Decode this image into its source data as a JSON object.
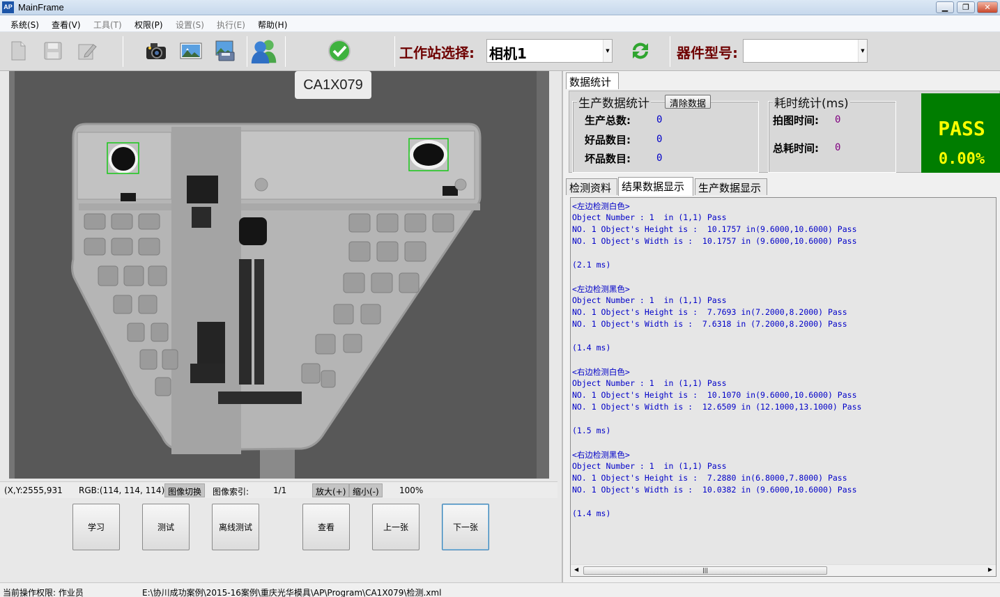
{
  "app": {
    "icon_text": "AP",
    "title": "MainFrame"
  },
  "window_buttons": {
    "minimize": "▁",
    "restore": "❐",
    "close": "✕"
  },
  "menu": [
    {
      "label": "系统(S)",
      "enabled": true
    },
    {
      "label": "查看(V)",
      "enabled": true
    },
    {
      "label": "工具(T)",
      "enabled": false
    },
    {
      "label": "权限(P)",
      "enabled": true
    },
    {
      "label": "设置(S)",
      "enabled": false
    },
    {
      "label": "执行(E)",
      "enabled": false
    },
    {
      "label": "帮助(H)",
      "enabled": true
    }
  ],
  "toolbar": {
    "icons": [
      "new-file-icon",
      "save-icon",
      "edit-icon",
      "camera-icon",
      "image-icon",
      "save-image-icon",
      "users-icon",
      "run-check-icon",
      "refresh-icon"
    ],
    "station_label": "工作站选择:",
    "station_value": "相机1",
    "part_label": "器件型号:",
    "part_value": ""
  },
  "image_view": {
    "part_code": "CA1X079"
  },
  "image_status": {
    "coords": "(X,Y:2555,931",
    "rgb": "RGB:(114, 114, 114)",
    "switch": "图像切换",
    "index_label": "图像索引:",
    "index_value": "1/1",
    "zoom_in": "放大(+)",
    "zoom_out": "缩小(-)",
    "zoom_value": "100%"
  },
  "actions": [
    "学习",
    "测试",
    "离线测试",
    "查看",
    "上一张",
    "下一张"
  ],
  "right": {
    "top_tab": "数据统计",
    "production": {
      "title": "生产数据统计",
      "clear": "清除数据",
      "total_label": "生产总数:",
      "total": "0",
      "good_label": "好品数目:",
      "good": "0",
      "bad_label": "坏品数目:",
      "bad": "0"
    },
    "timing": {
      "title": "耗时统计(ms)",
      "capture_label": "拍图时间:",
      "capture": "0",
      "total_label": "总耗时间:",
      "total": "0"
    },
    "result": {
      "status": "PASS",
      "rate": "0.00%"
    },
    "tabs": [
      "检测资料",
      "结果数据显示",
      "生产数据显示"
    ],
    "active_tab": 1,
    "log": [
      "<左边检测白色>",
      "Object Number : 1  in (1,1) Pass",
      "NO. 1 Object's Height is :  10.1757 in(9.6000,10.6000) Pass",
      "NO. 1 Object's Width is :  10.1757 in (9.6000,10.6000) Pass",
      "",
      "(2.1 ms)",
      "",
      "<左边检测黑色>",
      "Object Number : 1  in (1,1) Pass",
      "NO. 1 Object's Height is :  7.7693 in(7.2000,8.2000) Pass",
      "NO. 1 Object's Width is :  7.6318 in (7.2000,8.2000) Pass",
      "",
      "(1.4 ms)",
      "",
      "<右边检测白色>",
      "Object Number : 1  in (1,1) Pass",
      "NO. 1 Object's Height is :  10.1070 in(9.6000,10.6000) Pass",
      "NO. 1 Object's Width is :  12.6509 in (12.1000,13.1000) Pass",
      "",
      "(1.5 ms)",
      "",
      "<右边检测黑色>",
      "Object Number : 1  in (1,1) Pass",
      "NO. 1 Object's Height is :  7.2880 in(6.8000,7.8000) Pass",
      "NO. 1 Object's Width is :  10.0382 in (9.6000,10.6000) Pass",
      "",
      "(1.4 ms)"
    ],
    "scroll_grip": "|||"
  },
  "status_bar": {
    "permission": "当前操作权限: 作业员",
    "path": "E:\\协川成功案例\\2015-16案例\\重庆光华模具\\AP\\Program\\CA1X079\\检测.xml"
  },
  "colors": {
    "pass_bg": "#007d00",
    "pass_text": "#ffff00",
    "log_text": "#0000c8",
    "label_dark_red": "#6e0000"
  }
}
